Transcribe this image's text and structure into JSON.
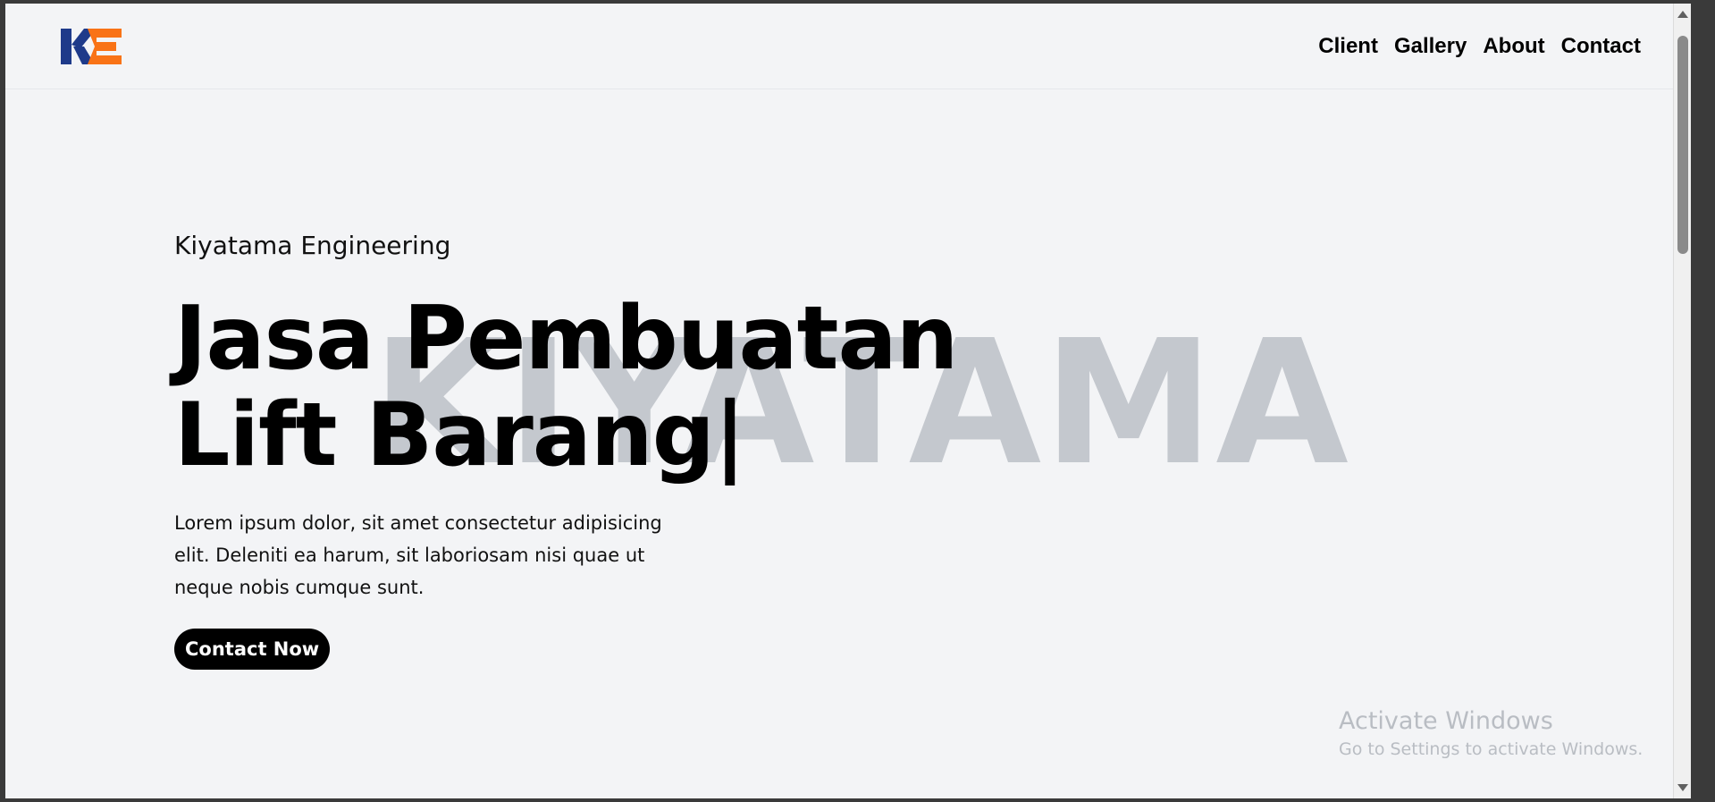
{
  "brand": {
    "logo_text": "KE",
    "colors": {
      "k": "#1e3a8a",
      "e": "#f97316"
    }
  },
  "nav": {
    "items": [
      {
        "label": "Client"
      },
      {
        "label": "Gallery"
      },
      {
        "label": "About"
      },
      {
        "label": "Contact"
      }
    ]
  },
  "hero": {
    "watermark": "KIYATAMA",
    "eyebrow": "Kiyatama Engineering",
    "title_line1": "Jasa Pembuatan",
    "title_line2": "Lift Barang|",
    "description": "Lorem ipsum dolor, sit amet consectetur adipisicing elit. Deleniti ea harum, sit laboriosam nisi quae ut neque nobis cumque sunt.",
    "cta_label": "Contact Now"
  },
  "system": {
    "activate_title": "Activate Windows",
    "activate_subtitle": "Go to Settings to activate Windows."
  }
}
